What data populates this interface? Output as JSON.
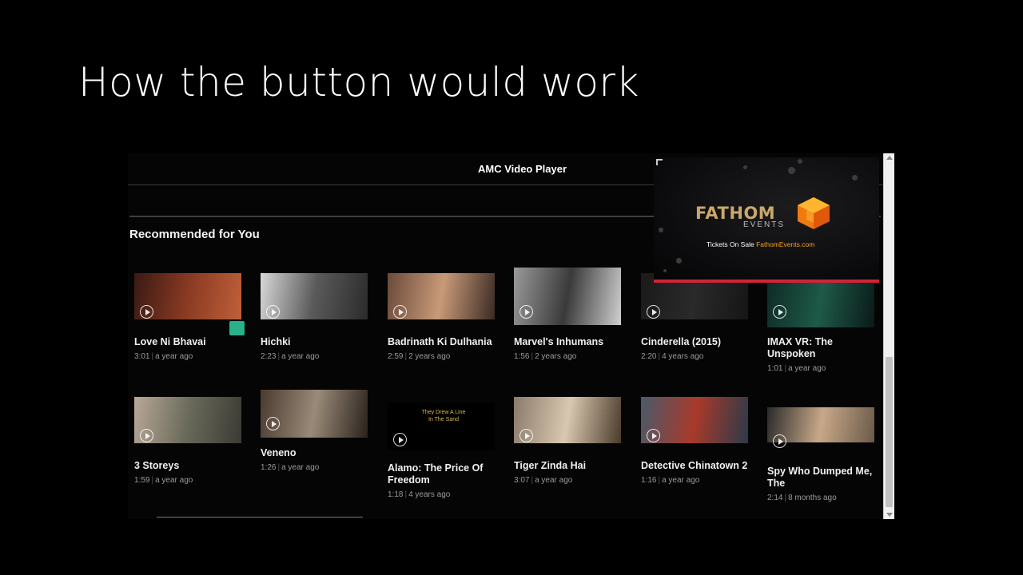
{
  "slide": {
    "title": "How the button would work"
  },
  "player": {
    "title": "AMC Video Player",
    "section_title": "Recommended for You"
  },
  "ad": {
    "brand": "FATHOM",
    "brand_sub": "EVENTS",
    "tickets_text": "Tickets On Sale",
    "tickets_link": "FathomEvents.com",
    "accent_color": "#d3233a"
  },
  "videos": [
    {
      "title": "Love Ni Bhavai",
      "duration": "3:01",
      "age": "a year ago",
      "thumb_colors": [
        "#3a1a14",
        "#8a3a22",
        "#c0603a"
      ]
    },
    {
      "title": "Hichki",
      "duration": "2:23",
      "age": "a year ago",
      "thumb_colors": [
        "#d8d8d8",
        "#5a5a5a",
        "#2b2b2b"
      ]
    },
    {
      "title": "Badrinath Ki Dulhania",
      "duration": "2:59",
      "age": "2 years ago",
      "thumb_colors": [
        "#6a4a3a",
        "#c89a78",
        "#3a2a24"
      ]
    },
    {
      "title": "Marvel's Inhumans",
      "duration": "1:56",
      "age": "2 years ago",
      "thumb_colors": [
        "#9a9a9a",
        "#3a3a3a",
        "#d0d0d0"
      ]
    },
    {
      "title": "Cinderella (2015)",
      "duration": "2:20",
      "age": "4 years ago",
      "thumb_colors": [
        "#1a1a1a",
        "#2a2a2a",
        "#151515"
      ]
    },
    {
      "title": "IMAX VR: The Unspoken",
      "duration": "1:01",
      "age": "a year ago",
      "thumb_colors": [
        "#0e2a24",
        "#1e5a48",
        "#0a1a18"
      ]
    },
    {
      "title": "3 Storeys",
      "duration": "1:59",
      "age": "a year ago",
      "thumb_colors": [
        "#b8a898",
        "#6a6a5a",
        "#3a3a34"
      ]
    },
    {
      "title": "Veneno",
      "duration": "1:26",
      "age": "a year ago",
      "thumb_colors": [
        "#4a3a30",
        "#9a8a78",
        "#2a221c"
      ]
    },
    {
      "title": "Alamo: The Price Of Freedom",
      "duration": "1:18",
      "age": "4 years ago",
      "thumb_colors": [
        "#000000",
        "#000000",
        "#000000"
      ],
      "thumb_caption": "They Drew A Line\nIn The Sand"
    },
    {
      "title": "Tiger Zinda Hai",
      "duration": "3:07",
      "age": "a year ago",
      "thumb_colors": [
        "#8a7a6a",
        "#d8c8b0",
        "#4a3a2a"
      ]
    },
    {
      "title": "Detective Chinatown 2",
      "duration": "1:16",
      "age": "a year ago",
      "thumb_colors": [
        "#4a5a6a",
        "#a83a2a",
        "#2a3a4a"
      ]
    },
    {
      "title": "Spy Who Dumped Me, The",
      "duration": "2:14",
      "age": "8 months ago",
      "thumb_colors": [
        "#2a2a2a",
        "#c8a888",
        "#6a5a4a"
      ]
    }
  ],
  "icons": {
    "play": "play-circle-icon",
    "corner": "expand-corner-icon",
    "cube": "fathom-cube-icon"
  }
}
